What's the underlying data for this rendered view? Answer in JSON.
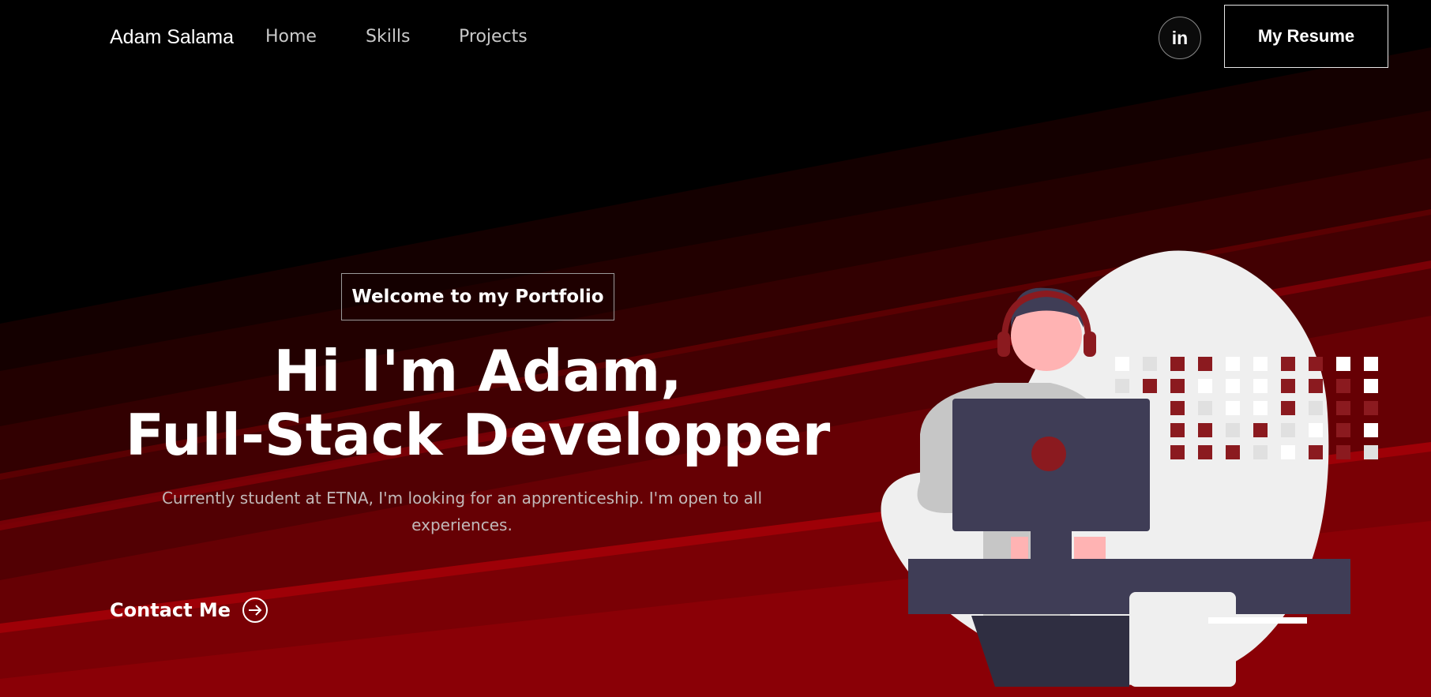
{
  "header": {
    "brand": "Adam Salama",
    "nav": [
      "Home",
      "Skills",
      "Projects"
    ],
    "linkedin_label": "in",
    "resume_label": "My Resume"
  },
  "hero": {
    "tagline": "Welcome to my Portfolio",
    "headline_line1": "Hi I'm Adam,",
    "headline_line2": "Full-Stack Developper",
    "subtext": "Currently student at ETNA, I'm looking for an apprenticeship. I'm open to all experiences.",
    "contact_label": "Contact Me"
  },
  "icons": {
    "linkedin": "linkedin-icon",
    "contact": "arrow-right-circle-icon",
    "illustration": "developer-at-computer-illustration"
  },
  "colors": {
    "background": "#000000",
    "accent_red": "#8b0f14",
    "text": "#ffffff",
    "muted": "#c2b9b9"
  }
}
